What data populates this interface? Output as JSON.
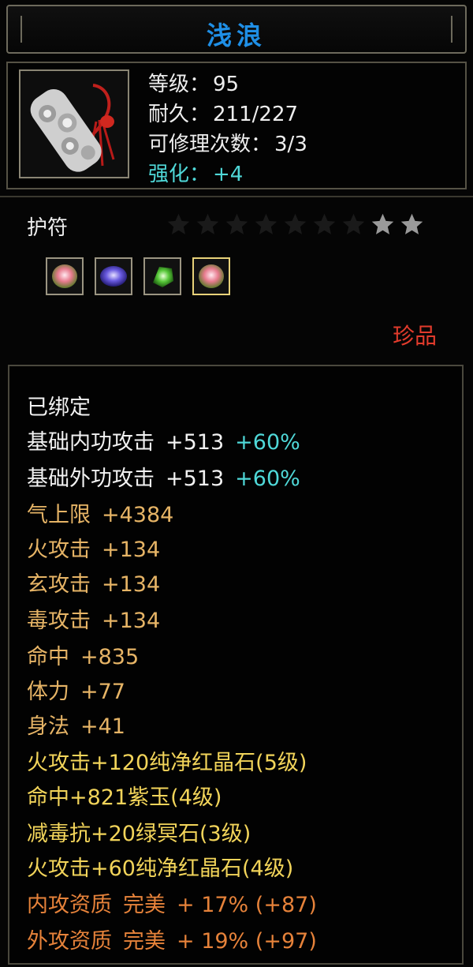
{
  "title": "浅浪",
  "item": {
    "icon_name": "amulet-icon",
    "stats": [
      {
        "label": "等级：",
        "value": "95"
      },
      {
        "label": "耐久：",
        "value": "211/227"
      },
      {
        "label": "可修理次数：",
        "value": "3/3"
      }
    ],
    "enhance": {
      "label": "强化：",
      "value": "+4"
    }
  },
  "type": "护符",
  "stars": {
    "total": 9,
    "lit": 2
  },
  "gems": [
    "red-crystal-gem-icon",
    "purple-jade-gem-icon",
    "green-stone-gem-icon",
    "red-crystal-gem-icon"
  ],
  "rarity": "珍品",
  "colors": {
    "title": "#1f8fe6",
    "rarity": "#e23b2c",
    "cyan": "#4fd8d8",
    "gold": "#e6b466",
    "yellow": "#f2d45a",
    "orange": "#e6823a"
  },
  "attributes": {
    "bound": "已绑定",
    "base_inner": {
      "label": "基础内功攻击",
      "value": "+513",
      "bonus": "+60%"
    },
    "base_outer": {
      "label": "基础外功攻击",
      "value": "+513",
      "bonus": "+60%"
    },
    "list": [
      {
        "label": "气上限",
        "value": "+4384"
      },
      {
        "label": "火攻击",
        "value": "+134"
      },
      {
        "label": "玄攻击",
        "value": "+134"
      },
      {
        "label": "毒攻击",
        "value": "+134"
      },
      {
        "label": "命中",
        "value": "+835"
      },
      {
        "label": "体力",
        "value": "+77"
      },
      {
        "label": "身法",
        "value": "+41"
      }
    ],
    "sockets": [
      "火攻击+120纯净红晶石(5级)",
      "命中+821紫玉(4级)",
      "减毒抗+20绿冥石(3级)",
      "火攻击+60纯净红晶石(4级)"
    ],
    "qualities": [
      {
        "label": "内攻资质",
        "grade": "完美",
        "value": "+ 17% (+87)"
      },
      {
        "label": "外攻资质",
        "grade": "完美",
        "value": "+ 19% (+97)"
      }
    ]
  }
}
